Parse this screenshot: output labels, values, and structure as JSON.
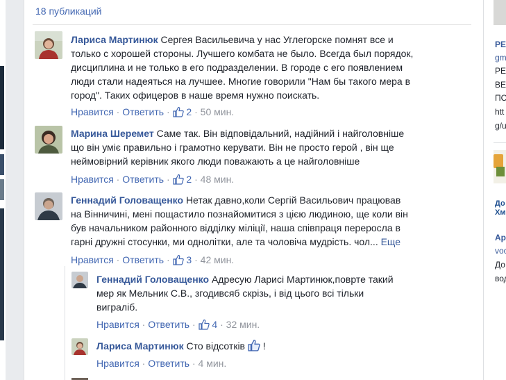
{
  "publications_count": "18 публикаций",
  "comments": [
    {
      "author": "Лариса Мартинюк",
      "lines": [
        "Сергея Васильевича у нас Углегорске помнят все и",
        "только с хорошей стороны. Лучшего комбата не было. Всегда был порядок,",
        "дисциплина и не только в его подразделении. В городе с его появлением",
        "люди стали надеяться на лучшее. Многие говорили \"Нам бы такого мера в",
        "город\". Таких офицеров в наше время нужно поискать."
      ],
      "like_label": "Нравится",
      "reply_label": "Ответить",
      "likes": "2",
      "time": "50 мин."
    },
    {
      "author": "Марина Шеремет",
      "lines": [
        "Саме так. Він відповідальний, надійний і найголовніше",
        "що він уміє правильно і грамотно керувати. Він не просто герой , він ще",
        "неймовірний керівник якого люди поважають а це найголовніше"
      ],
      "like_label": "Нравится",
      "reply_label": "Ответить",
      "likes": "2",
      "time": "48 мин."
    },
    {
      "author": "Геннадий Головащенко",
      "lines": [
        "Нетак давно,коли Сергій Васильович працював",
        "на Вінничині, мені пощастило познайомитися з цією людиною, ще коли він",
        "був начальником районного відділку міліції, наша співпраця переросла в",
        "гарні дружні стосунки, ми однолітки, але та чоловіча мудрість. чол..."
      ],
      "more_label": "Еще",
      "like_label": "Нравится",
      "reply_label": "Ответить",
      "likes": "3",
      "time": "42 мин."
    }
  ],
  "replies": [
    {
      "author": "Геннадий Головащенко",
      "lines": [
        "Адресую Ларисі Мартинюк,поврте такий",
        "мер як Мельник С.В., згодивсяб скрізь, і від цього всі тільки",
        "виграліб."
      ],
      "like_label": "Нравится",
      "reply_label": "Ответить",
      "likes": "4",
      "time": "32 мин."
    },
    {
      "author": "Лариса Мартинюк",
      "text_before": "Сто відсотків",
      "text_after": "!",
      "like_label": "Нравится",
      "reply_label": "Ответить",
      "time": "4 мин."
    }
  ],
  "right_column": {
    "title": "PE",
    "link": "gm",
    "lines": [
      "PE",
      "BE",
      "ПС",
      "htt",
      "g/u"
    ],
    "ad_caption": "До Хм",
    "ad2_title": "Ар",
    "ad2_link": "voc",
    "ad2_lines": [
      "До",
      "вод"
    ]
  },
  "colors": {
    "link": "#365899",
    "meta": "#90949c",
    "accent": "#4267b2"
  }
}
